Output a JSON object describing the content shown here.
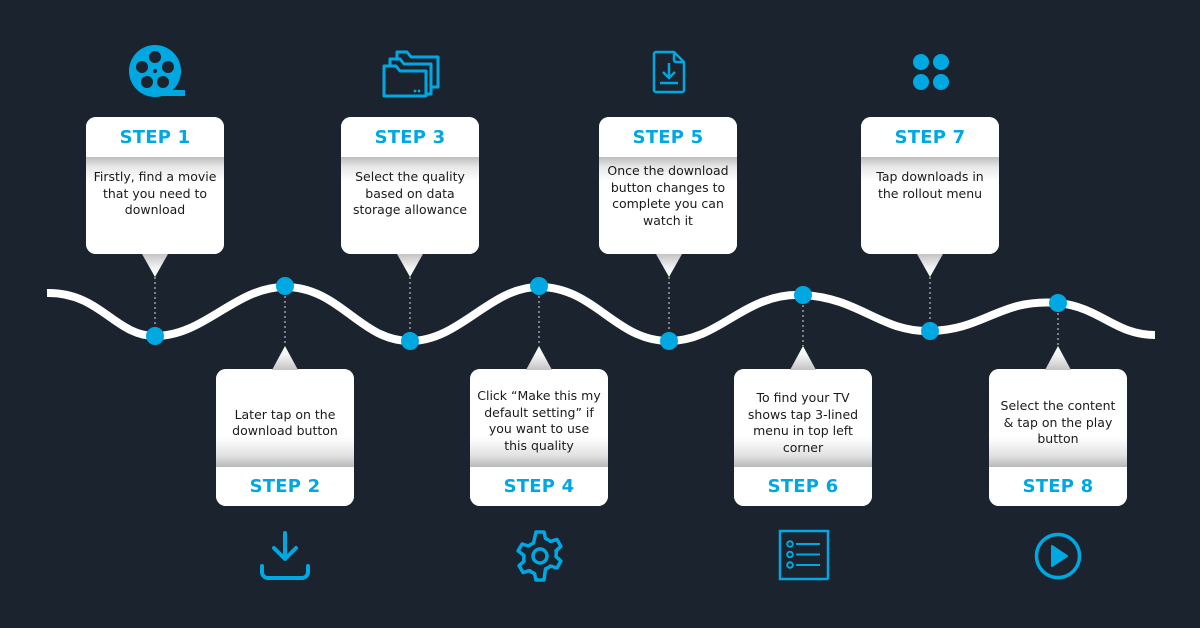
{
  "accent_color": "#00a8e1",
  "background_color": "#1b232e",
  "steps": [
    {
      "label": "STEP 1",
      "text": "Firstly, find a movie that you need to download",
      "icon": "film-reel-icon",
      "position": "top"
    },
    {
      "label": "STEP 2",
      "text": "Later tap on the download button",
      "icon": "download-tray-icon",
      "position": "bottom"
    },
    {
      "label": "STEP 3",
      "text": "Select the quality based on data storage allowance",
      "icon": "folders-icon",
      "position": "top"
    },
    {
      "label": "STEP 4",
      "text": "Click “Make this my default setting” if you want to use this quality",
      "icon": "gear-icon",
      "position": "bottom"
    },
    {
      "label": "STEP 5",
      "text": "Once the download button changes to complete you can watch it",
      "icon": "file-download-icon",
      "position": "top"
    },
    {
      "label": "STEP 6",
      "text": "To find your TV shows tap 3-lined menu in top left corner",
      "icon": "list-menu-icon",
      "position": "bottom"
    },
    {
      "label": "STEP 7",
      "text": "Tap downloads in the rollout menu",
      "icon": "four-dots-icon",
      "position": "top"
    },
    {
      "label": "STEP 8",
      "text": "Select the content & tap on the play button",
      "icon": "play-circle-icon",
      "position": "bottom"
    }
  ]
}
